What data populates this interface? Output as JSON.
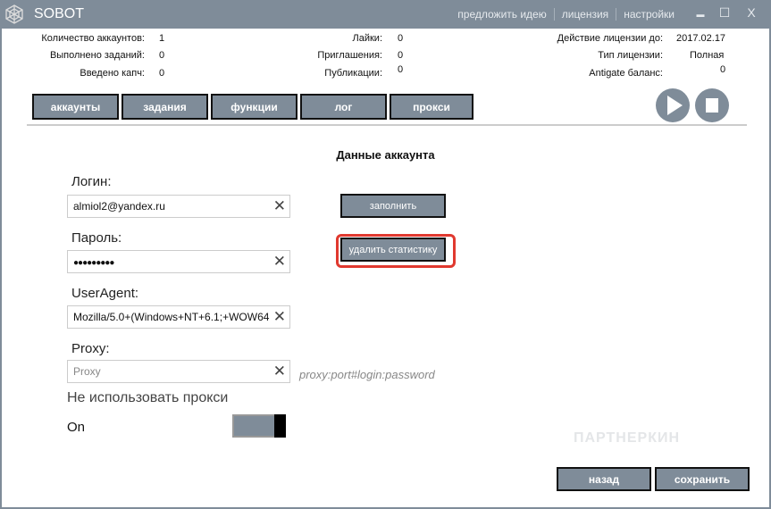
{
  "title": "SOBOT",
  "title_links": [
    "предложить идею",
    "лицензия",
    "настройки"
  ],
  "window_controls": {
    "minimize": "▬",
    "maximize": "☐",
    "close": "X"
  },
  "stats": {
    "accounts_label": "Количество аккаунтов:",
    "accounts": "1",
    "tasks_label": "Выполнено заданий:",
    "tasks": "0",
    "captcha_label": "Введено капч:",
    "captcha": "0",
    "likes_label": "Лайки:",
    "likes": "0",
    "invites_label": "Приглашения:",
    "invites": "0",
    "posts_label": "Публикации:",
    "posts": "0",
    "license_until_label": "Действие лицензии до:",
    "license_until": "2017.02.17",
    "license_type_label": "Тип лицензии:",
    "license_type": "Полная",
    "antigate_label": "Antigate баланс:",
    "antigate": "0"
  },
  "nav": [
    "аккаунты",
    "задания",
    "функции",
    "лог",
    "прокси"
  ],
  "heading": "Данные аккаунта",
  "form": {
    "login_label": "Логин:",
    "login": "almiol2@yandex.ru",
    "password_label": "Пароль:",
    "password": "●●●●●●●●●",
    "ua_label": "UserAgent:",
    "ua": "Mozilla/5.0+(Windows+NT+6.1;+WOW64",
    "proxy_label": "Proxy:",
    "proxy_placeholder": "Proxy",
    "proxy_hint": "proxy:port#login:password",
    "no_proxy_label": "Не использовать прокси",
    "toggle_state": "On",
    "clear": "✕"
  },
  "buttons": {
    "fill": "заполнить",
    "delete_stats": "удалить статистику",
    "back": "назад",
    "save": "сохранить"
  },
  "watermark": "ПАРТНЕРКИН"
}
